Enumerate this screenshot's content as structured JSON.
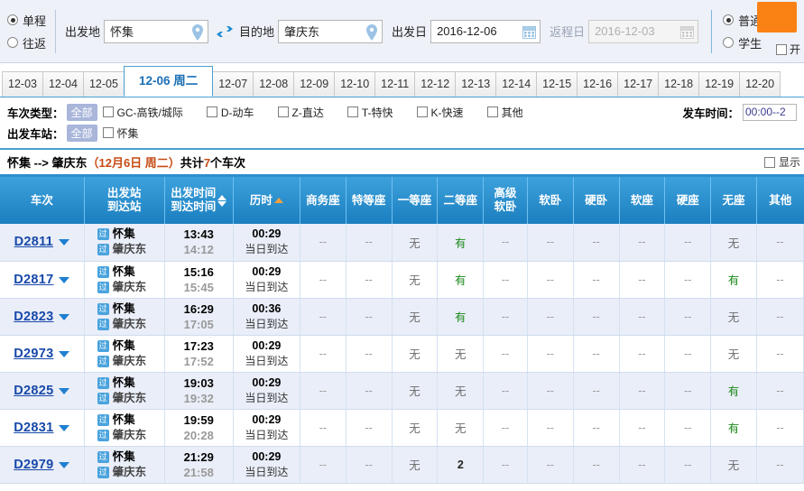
{
  "search": {
    "trip_types": [
      {
        "label": "单程",
        "selected": true
      },
      {
        "label": "往返",
        "selected": false
      }
    ],
    "from_label": "出发地",
    "from_value": "怀集",
    "to_label": "目的地",
    "to_value": "肇庆东",
    "depart_label": "出发日",
    "depart_value": "2016-12-06",
    "return_label": "返程日",
    "return_value": "2016-12-03",
    "passenger_types": [
      {
        "label": "普通",
        "selected": true
      },
      {
        "label": "学生",
        "selected": false
      }
    ],
    "search_button_label": "",
    "open_checkbox_label": "开",
    "icons": {
      "from_pin": "location-pin-icon",
      "to_pin": "location-pin-icon",
      "swap": "swap-arrows-icon",
      "calendar": "calendar-icon"
    },
    "accent_orange": "#fa8215"
  },
  "date_tabs": {
    "items": [
      {
        "label": "12-03",
        "active": false
      },
      {
        "label": "12-04",
        "active": false
      },
      {
        "label": "12-05",
        "active": false
      },
      {
        "label": "12-06 周二",
        "active": true
      },
      {
        "label": "12-07",
        "active": false
      },
      {
        "label": "12-08",
        "active": false
      },
      {
        "label": "12-09",
        "active": false
      },
      {
        "label": "12-10",
        "active": false
      },
      {
        "label": "12-11",
        "active": false
      },
      {
        "label": "12-12",
        "active": false
      },
      {
        "label": "12-13",
        "active": false
      },
      {
        "label": "12-14",
        "active": false
      },
      {
        "label": "12-15",
        "active": false
      },
      {
        "label": "12-16",
        "active": false
      },
      {
        "label": "12-17",
        "active": false
      },
      {
        "label": "12-18",
        "active": false
      },
      {
        "label": "12-19",
        "active": false
      },
      {
        "label": "12-20",
        "active": false
      }
    ]
  },
  "filters": {
    "train_type_label": "车次类型：",
    "train_type_all": "全部",
    "train_types": [
      {
        "label": "GC-高铁/城际",
        "checked": false
      },
      {
        "label": "D-动车",
        "checked": false
      },
      {
        "label": "Z-直达",
        "checked": false
      },
      {
        "label": "T-特快",
        "checked": false
      },
      {
        "label": "K-快速",
        "checked": false
      },
      {
        "label": "其他",
        "checked": false
      }
    ],
    "depart_station_label": "出发车站：",
    "depart_station_all": "全部",
    "depart_stations": [
      {
        "label": "怀集",
        "checked": false
      }
    ],
    "depart_time_label": "发车时间：",
    "depart_time_value": "00:00--2"
  },
  "summary": {
    "route": "怀集 --> 肇庆东",
    "date_part": "（12月6日  周二）",
    "count_prefix": "共计",
    "count": "7",
    "count_suffix": "个车次",
    "show_all_label": "显示",
    "show_all_checked": false
  },
  "table": {
    "headers": [
      {
        "label": "车次",
        "sort": null
      },
      {
        "label": "出发站\n到达站",
        "sort": null
      },
      {
        "label": "出发时间\n到达时间",
        "sort": "both"
      },
      {
        "label": "历时",
        "sort": "up-orange"
      },
      {
        "label": "商务座",
        "sort": null
      },
      {
        "label": "特等座",
        "sort": null
      },
      {
        "label": "一等座",
        "sort": null
      },
      {
        "label": "二等座",
        "sort": null
      },
      {
        "label": "高级\n软卧",
        "sort": null
      },
      {
        "label": "软卧",
        "sort": null
      },
      {
        "label": "硬卧",
        "sort": null
      },
      {
        "label": "软座",
        "sort": null
      },
      {
        "label": "硬座",
        "sort": null
      },
      {
        "label": "无座",
        "sort": null
      },
      {
        "label": "其他",
        "sort": null
      }
    ],
    "rows": [
      {
        "train": "D2811",
        "from": "怀集",
        "to": "肇庆东",
        "dep": "13:43",
        "arr": "14:12",
        "duration": "00:29",
        "arrive_day": "当日到达",
        "seats": [
          "--",
          "--",
          "无",
          "有",
          "--",
          "--",
          "--",
          "--",
          "--",
          "无",
          "--"
        ]
      },
      {
        "train": "D2817",
        "from": "怀集",
        "to": "肇庆东",
        "dep": "15:16",
        "arr": "15:45",
        "duration": "00:29",
        "arrive_day": "当日到达",
        "seats": [
          "--",
          "--",
          "无",
          "有",
          "--",
          "--",
          "--",
          "--",
          "--",
          "有",
          "--"
        ]
      },
      {
        "train": "D2823",
        "from": "怀集",
        "to": "肇庆东",
        "dep": "16:29",
        "arr": "17:05",
        "duration": "00:36",
        "arrive_day": "当日到达",
        "seats": [
          "--",
          "--",
          "无",
          "有",
          "--",
          "--",
          "--",
          "--",
          "--",
          "无",
          "--"
        ]
      },
      {
        "train": "D2973",
        "from": "怀集",
        "to": "肇庆东",
        "dep": "17:23",
        "arr": "17:52",
        "duration": "00:29",
        "arrive_day": "当日到达",
        "seats": [
          "--",
          "--",
          "无",
          "无",
          "--",
          "--",
          "--",
          "--",
          "--",
          "无",
          "--"
        ]
      },
      {
        "train": "D2825",
        "from": "怀集",
        "to": "肇庆东",
        "dep": "19:03",
        "arr": "19:32",
        "duration": "00:29",
        "arrive_day": "当日到达",
        "seats": [
          "--",
          "--",
          "无",
          "无",
          "--",
          "--",
          "--",
          "--",
          "--",
          "有",
          "--"
        ]
      },
      {
        "train": "D2831",
        "from": "怀集",
        "to": "肇庆东",
        "dep": "19:59",
        "arr": "20:28",
        "duration": "00:29",
        "arrive_day": "当日到达",
        "seats": [
          "--",
          "--",
          "无",
          "无",
          "--",
          "--",
          "--",
          "--",
          "--",
          "有",
          "--"
        ]
      },
      {
        "train": "D2979",
        "from": "怀集",
        "to": "肇庆东",
        "dep": "21:29",
        "arr": "21:58",
        "duration": "00:29",
        "arrive_day": "当日到达",
        "seats": [
          "--",
          "--",
          "无",
          "2",
          "--",
          "--",
          "--",
          "--",
          "--",
          "无",
          "--"
        ]
      }
    ],
    "station_badge": "过"
  }
}
